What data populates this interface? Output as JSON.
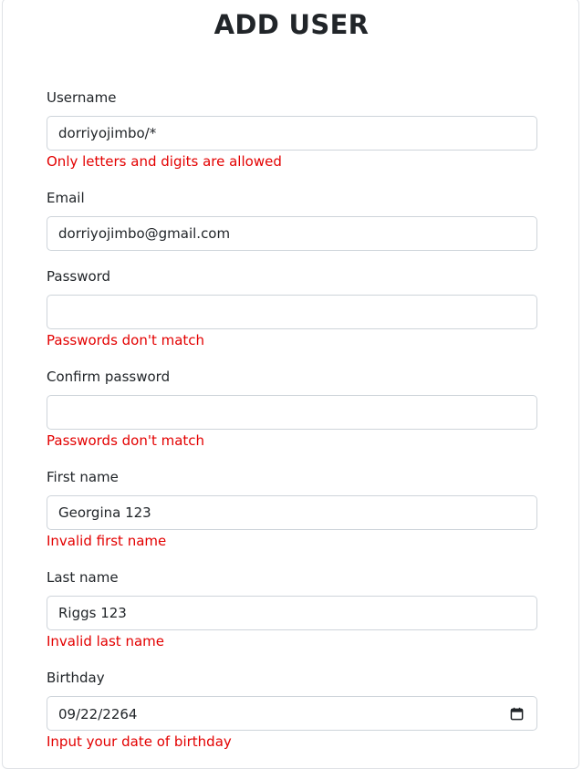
{
  "form": {
    "title": "ADD USER",
    "username": {
      "label": "Username",
      "value": "dorriyojimbo/*",
      "error": "Only letters and digits are allowed"
    },
    "email": {
      "label": "Email",
      "value": "dorriyojimbo@gmail.com"
    },
    "password": {
      "label": "Password",
      "value": "",
      "error": "Passwords don't match"
    },
    "confirm_password": {
      "label": "Confirm password",
      "value": "",
      "error": "Passwords don't match"
    },
    "first_name": {
      "label": "First name",
      "value": "Georgina 123",
      "error": "Invalid first name"
    },
    "last_name": {
      "label": "Last name",
      "value": "Riggs 123",
      "error": "Invalid last name"
    },
    "birthday": {
      "label": "Birthday",
      "value": "09/22/2264",
      "icon": "calendar-icon",
      "error": "Input your date of birthday"
    }
  },
  "colors": {
    "error": "#e30000",
    "border": "#ced4da",
    "text": "#212529"
  }
}
